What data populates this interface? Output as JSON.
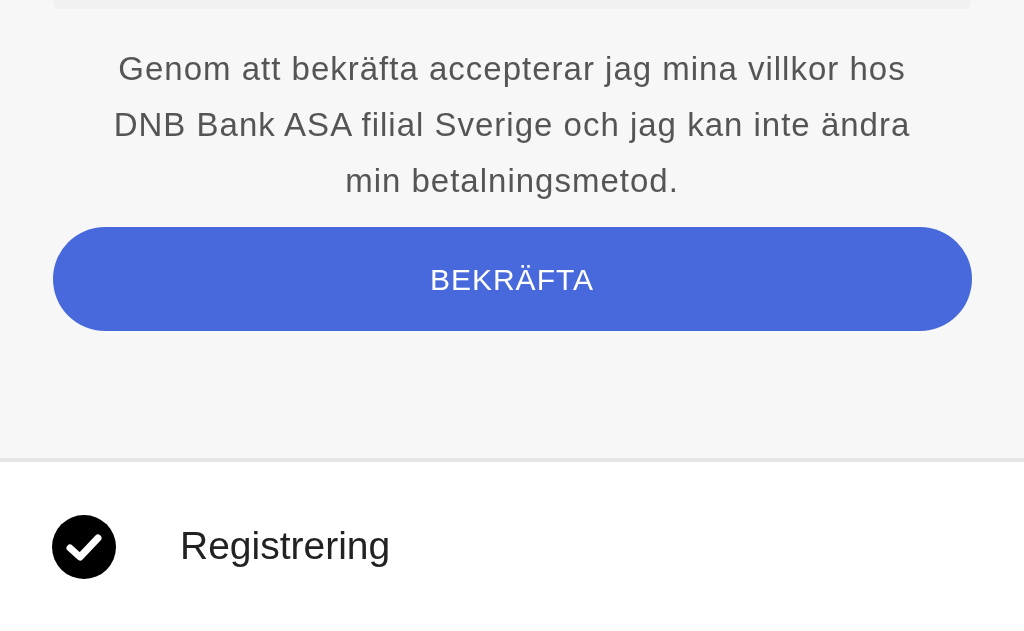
{
  "terms": "Genom att bekräfta accepterar jag mina villkor hos DNB Bank ASA filial Sverige och jag kan inte ändra min betalningsmetod.",
  "confirm_button": {
    "label": "BEKRÄFTA"
  },
  "steps": [
    {
      "label": "Registrering",
      "done": true
    }
  ]
}
